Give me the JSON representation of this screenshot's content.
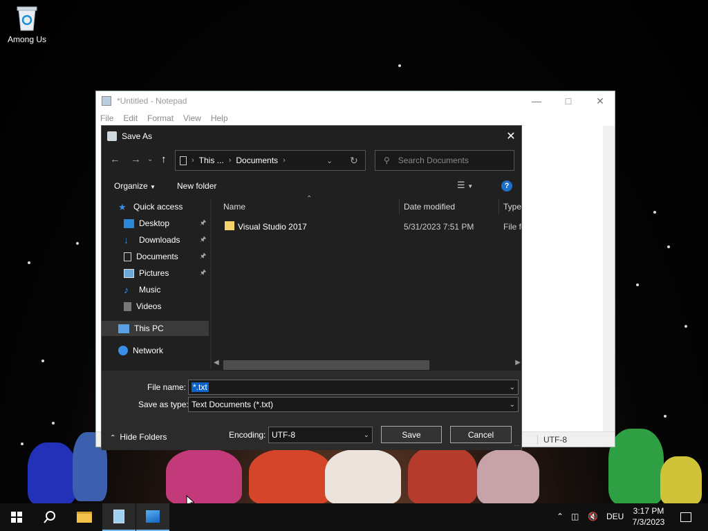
{
  "desktop": {
    "icon_label": "Among Us"
  },
  "notepad": {
    "title": "*Untitled - Notepad",
    "menu": [
      "File",
      "Edit",
      "Format",
      "View",
      "Help"
    ],
    "status_encoding": "UTF-8"
  },
  "dialog": {
    "title": "Save As",
    "breadcrumb": [
      "This ...",
      "Documents"
    ],
    "search_placeholder": "Search Documents",
    "organize_label": "Organize",
    "new_folder_label": "New folder",
    "nav": {
      "quick_access": "Quick access",
      "items": [
        {
          "label": "Desktop",
          "icon": "desktop-icon",
          "pinned": true
        },
        {
          "label": "Downloads",
          "icon": "downloads-icon",
          "pinned": true
        },
        {
          "label": "Documents",
          "icon": "documents-icon",
          "pinned": true
        },
        {
          "label": "Pictures",
          "icon": "pictures-icon",
          "pinned": true
        },
        {
          "label": "Music",
          "icon": "music-icon",
          "pinned": false
        },
        {
          "label": "Videos",
          "icon": "videos-icon",
          "pinned": false
        }
      ],
      "this_pc": "This PC",
      "network": "Network"
    },
    "columns": [
      "Name",
      "Date modified",
      "Type"
    ],
    "files": [
      {
        "name": "Visual Studio 2017",
        "date": "5/31/2023 7:51 PM",
        "type": "File fo"
      }
    ],
    "file_name_label": "File name:",
    "file_name_value": "*.txt",
    "save_type_label": "Save as type:",
    "save_type_value": "Text Documents (*.txt)",
    "hide_folders_label": "Hide Folders",
    "encoding_label": "Encoding:",
    "encoding_value": "UTF-8",
    "save_label": "Save",
    "cancel_label": "Cancel"
  },
  "taskbar": {
    "language": "DEU",
    "time": "3:17 PM",
    "date": "7/3/2023"
  },
  "colors": {
    "accent": "#1e6fc9",
    "folder": "#f3d46b",
    "selection": "#0a64c8"
  }
}
